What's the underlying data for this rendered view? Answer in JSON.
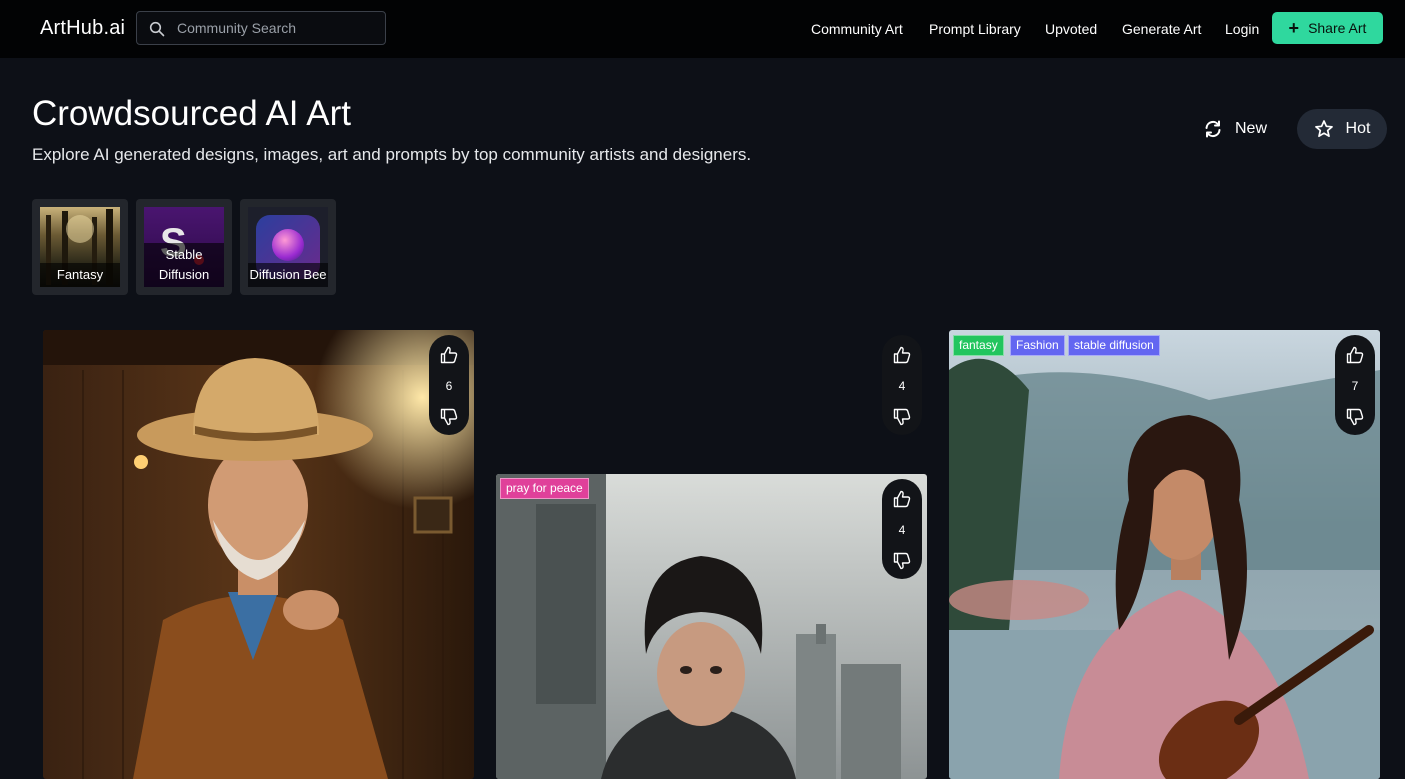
{
  "app": {
    "logo": "ArtHub.ai"
  },
  "search": {
    "placeholder": "Community Search"
  },
  "nav": {
    "community_art": "Community Art",
    "prompt_library": "Prompt Library",
    "upvoted": "Upvoted",
    "generate_art": "Generate Art",
    "login": "Login",
    "share_art": "Share Art"
  },
  "hero": {
    "title": "Crowdsourced AI Art",
    "subtitle": "Explore AI generated designs, images, art and prompts by top community artists and designers."
  },
  "sort": {
    "new_label": "New",
    "hot_label": "Hot"
  },
  "categories": [
    {
      "label": "Fantasy"
    },
    {
      "label": "Stable Diffusion",
      "glyph": "S"
    },
    {
      "label": "Diffusion Bee"
    }
  ],
  "cards": [
    {
      "votes": "6",
      "tags": []
    },
    {
      "votes": "4",
      "tags": []
    },
    {
      "votes": "4",
      "tags": [
        "pray for peace"
      ]
    },
    {
      "votes": "7",
      "tags": [
        "fantasy",
        "Fashion",
        "stable diffusion"
      ]
    }
  ],
  "colors": {
    "accent": "#2fd89e",
    "background": "#0d1017",
    "topbar": "#020304",
    "tag_pink": "#e0409a",
    "tag_green": "#22c55e",
    "tag_indigo": "#6366f1"
  },
  "icons": [
    "search-icon",
    "plus-icon",
    "refresh-icon",
    "star-icon",
    "thumbs-up-icon",
    "thumbs-down-icon"
  ]
}
